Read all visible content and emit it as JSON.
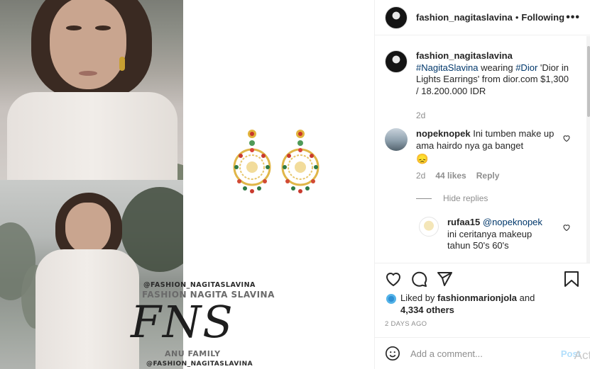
{
  "header": {
    "username": "fashion_nagitaslavina",
    "separator": "•",
    "follow_label": "Following",
    "more_label": "•••"
  },
  "caption": {
    "username": "fashion_nagitaslavina",
    "hashtag1": "#NagitaSlavina",
    "text1": " wearing ",
    "hashtag2": "#Dior",
    "text2": " 'Dior in Lights Earrings' from dior.com $1,300 / 18.200.000 IDR",
    "time": "2d"
  },
  "comments": [
    {
      "username": "nopeknopek",
      "text": "Ini tumben make up ama hairdo nya ga banget",
      "emoji": "😞",
      "time": "2d",
      "likes": "44 likes",
      "reply_label": "Reply"
    }
  ],
  "hide_replies": "Hide replies",
  "reply": {
    "username": "rufaa15",
    "mention": "@nopeknopek",
    "text": "ini ceritanya makeup tahun 50's 60's"
  },
  "likes": {
    "prefix": "Liked by ",
    "user": "fashionmarionjola",
    "middle": " and",
    "count": "4,334 others"
  },
  "date": "2 DAYS AGO",
  "comment_box": {
    "placeholder": "Add a comment...",
    "post_label": "Post"
  },
  "watermark": {
    "handle_top": "@FASHION_NAGITASLAVINA",
    "name": "FASHION NAGITA SLAVINA",
    "logo": "FNS",
    "family": "ANU FAMILY",
    "handle_bottom": "@FASHION_NAGITASLAVINA"
  },
  "overlay": {
    "activate": "Acti"
  },
  "colors": {
    "link": "#00376b",
    "post_disabled": "#b2dffc",
    "muted": "#8e8e8e"
  }
}
